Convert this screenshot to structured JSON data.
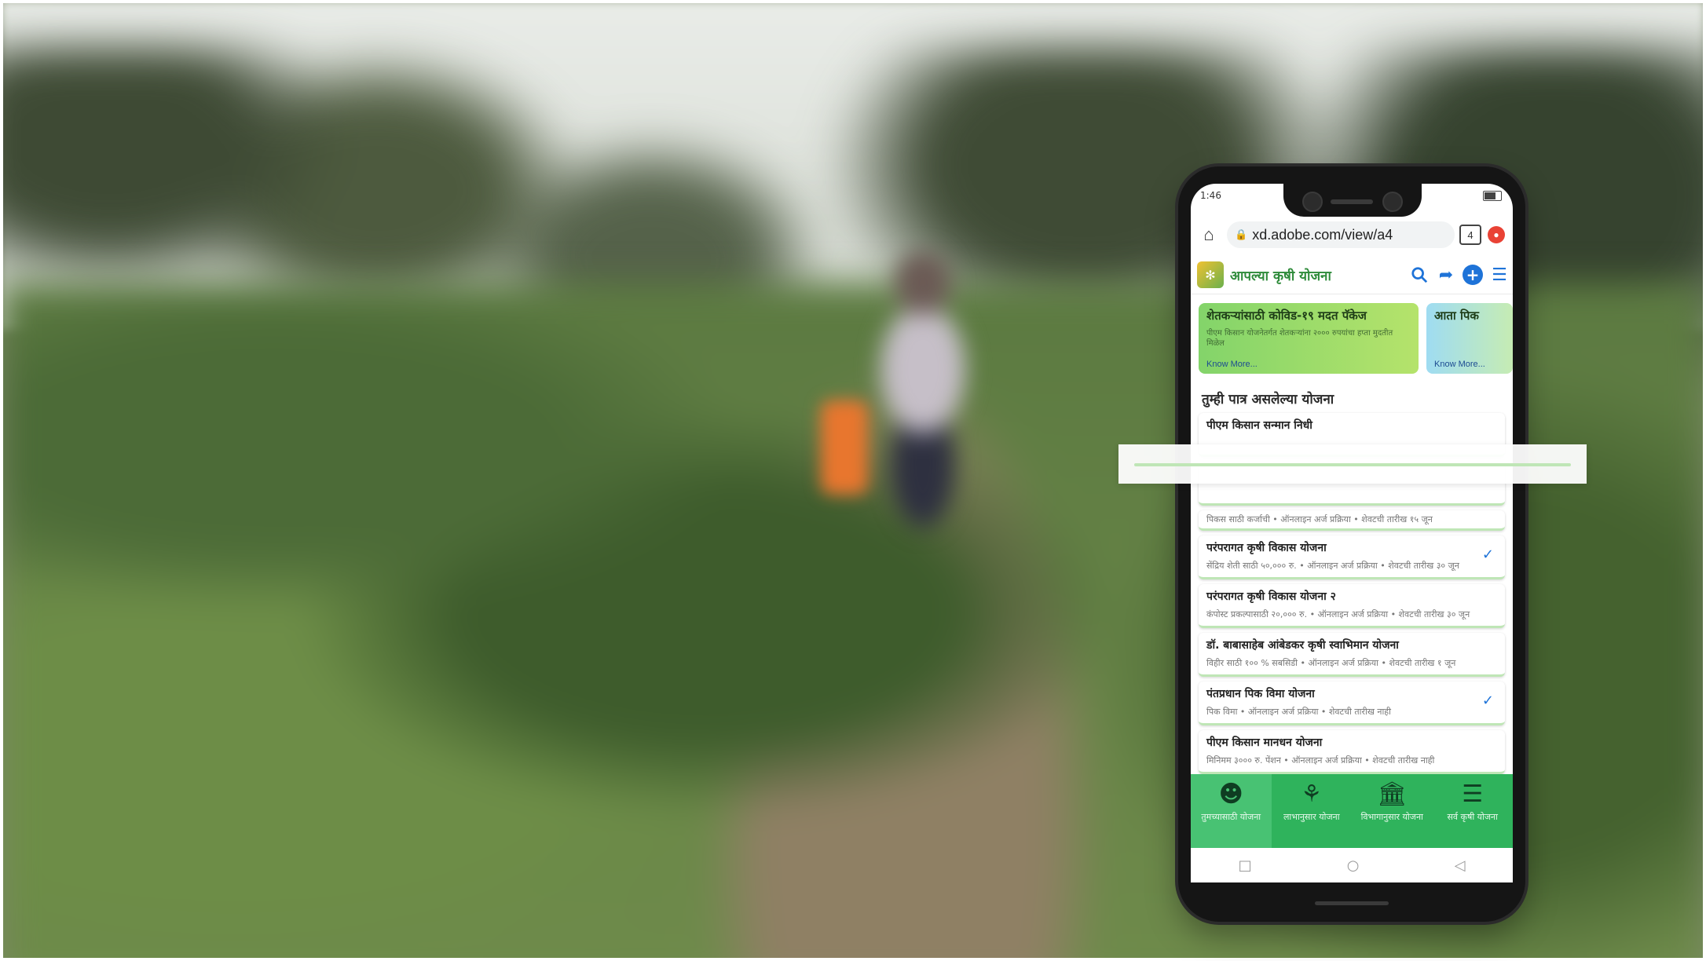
{
  "browser": {
    "status_time": "1:46",
    "url": "xd.adobe.com/view/a4",
    "tab_count": "4"
  },
  "app": {
    "title": "आपल्या कृषी योजना",
    "icons": [
      "search-icon",
      "share-icon",
      "add-icon",
      "menu-icon"
    ]
  },
  "banners": [
    {
      "title": "शेतकऱ्यांसाठी कोविड-१९ मदत पॅकेज",
      "desc": "पीएम किसान योजनेतर्गत शेतकऱ्यांना २००० रुपयांचा हप्ता मुदतीत मिळेल",
      "link": "Know More..."
    },
    {
      "title": "आता पिक",
      "desc": "",
      "link": "Know More..."
    }
  ],
  "section_title": "तुम्ही पात्र असलेल्या योजना",
  "schemes": [
    {
      "title": "पीएम किसान सन्मान निधी",
      "desc": "",
      "checked": false
    },
    {
      "title": "",
      "desc": "",
      "checked": false
    },
    {
      "title": "",
      "desc": "पिकस साठी कर्जाची • ऑनलाइन अर्ज प्रक्रिया • शेवटची तारीख १५ जून",
      "checked": false
    },
    {
      "title": "परंपरागत कृषी विकास योजना",
      "desc": "सेंद्रिय शेती साठी ५०,००० रु. • ऑनलाइन अर्ज प्रक्रिया • शेवटची तारीख ३० जून",
      "checked": true
    },
    {
      "title": "परंपरागत कृषी विकास योजना २",
      "desc": "कंपोस्ट प्रकल्पासाठी २०,००० रु. • ऑनलाइन अर्ज प्रक्रिया • शेवटची तारीख ३० जून",
      "checked": false
    },
    {
      "title": "डॉ. बाबासाहेब आंबेडकर कृषी स्वाभिमान योजना",
      "desc": "विहीर साठी १०० % सबसिडी • ऑनलाइन अर्ज प्रक्रिया • शेवटची तारीख १ जून",
      "checked": false
    },
    {
      "title": "पंतप्रधान पिक विमा योजना",
      "desc": "पिक विमा • ऑनलाइन अर्ज प्रक्रिया • शेवटची तारीख नाही",
      "checked": true
    },
    {
      "title": "पीएम किसान मानधन योजना",
      "desc": "मिनिमम ३००० रु. पेंशन • ऑनलाइन अर्ज प्रक्रिया • शेवटची तारीख नाही",
      "checked": false
    }
  ],
  "bottom_nav": [
    {
      "label": "तुमच्यासाठी योजना",
      "icon": "person-icon",
      "active": true
    },
    {
      "label": "लाभानुसार योजना",
      "icon": "benefit-icon",
      "active": false
    },
    {
      "label": "विभागानुसार योजना",
      "icon": "department-icon",
      "active": false
    },
    {
      "label": "सर्व कृषी योजना",
      "icon": "list-icon",
      "active": false
    }
  ],
  "colors": {
    "brand_green": "#2fb35c",
    "accent_blue": "#1e73d8",
    "title_green": "#2e8b3a"
  }
}
